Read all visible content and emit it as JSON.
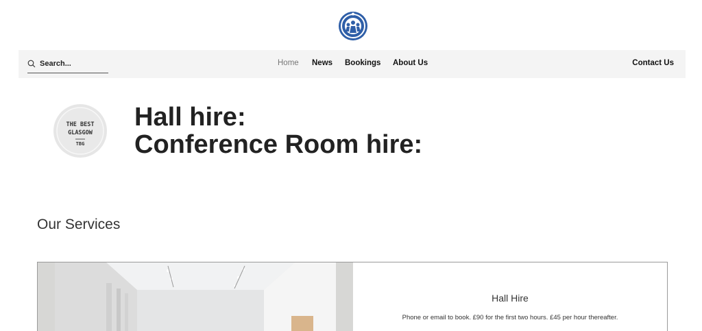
{
  "logo": {
    "icon": "community-circle-icon",
    "color": "#2f5fa8"
  },
  "header": {
    "search": {
      "placeholder": "Search...",
      "icon": "search-icon"
    },
    "nav": {
      "home": "Home",
      "news": "News",
      "bookings": "Bookings",
      "about": "About Us",
      "contact": "Contact Us",
      "active": "Home"
    }
  },
  "badge": {
    "line1": "THE BEST",
    "line2": "GLASGOW",
    "line3": "TBG"
  },
  "hero": {
    "line1": "Hall hire:",
    "line2": "Conference Room hire:"
  },
  "services": {
    "title": "Our Services",
    "items": [
      {
        "title": "Hall Hire",
        "description": "Phone or email to book. £90 for the first two hours. £45 per hour thereafter."
      }
    ]
  }
}
